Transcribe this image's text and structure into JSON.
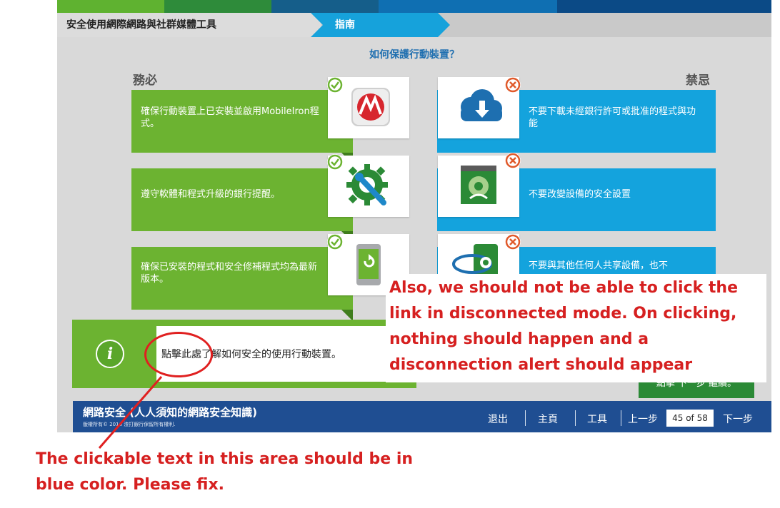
{
  "header": {
    "breadcrumb_title": "安全使用網際網路與社群媒體工具",
    "section_tab": "指南",
    "question": "如何保護行動裝置？"
  },
  "columns": {
    "must_heading": "務必",
    "dont_heading": "禁忌"
  },
  "dos": [
    {
      "text": "確保行動裝置上已安裝並啟用MobileIron程式。",
      "icon": "mobileiron-app-icon"
    },
    {
      "text": "遵守軟體和程式升級的銀行提醒。",
      "icon": "settings-wrench-icon"
    },
    {
      "text": "確保已安裝的程式和安全修補程式均為最新版本。",
      "icon": "phone-refresh-icon"
    }
  ],
  "donts": [
    {
      "text": "不要下載未經銀行許可或批准的程式與功能",
      "icon": "cloud-download-icon"
    },
    {
      "text": "不要改變設備的安全設置",
      "icon": "browser-security-icon"
    },
    {
      "text": "不要與其他任何人共享設備，也不",
      "icon": "share-device-icon"
    }
  ],
  "info": {
    "icon": "info-icon",
    "link_text": "點擊此處了解如何安全的使用行動裝置。"
  },
  "next_hint": "點擊 下一步 繼續。",
  "footer": {
    "course_title": "網路安全 (人人須知的網路安全知識)",
    "copyright": "版權所有© 2016 渣打銀行保留所有權利.",
    "exit": "退出",
    "home": "主頁",
    "tools": "工具",
    "prev": "上一步",
    "page_indicator": "45 of 58",
    "next": "下一步"
  },
  "annotations": {
    "disconnected_note": "Also, we should not be able to click the link in disconnected mode. On clicking, nothing should happen and a disconnection alert should appear",
    "link_color_note": "The clickable text in this area should be in blue color. Please fix."
  },
  "colors": {
    "green": "#6cb331",
    "blue": "#14a3dd",
    "navy": "#1f4e92",
    "annotation_red": "#d62020"
  }
}
